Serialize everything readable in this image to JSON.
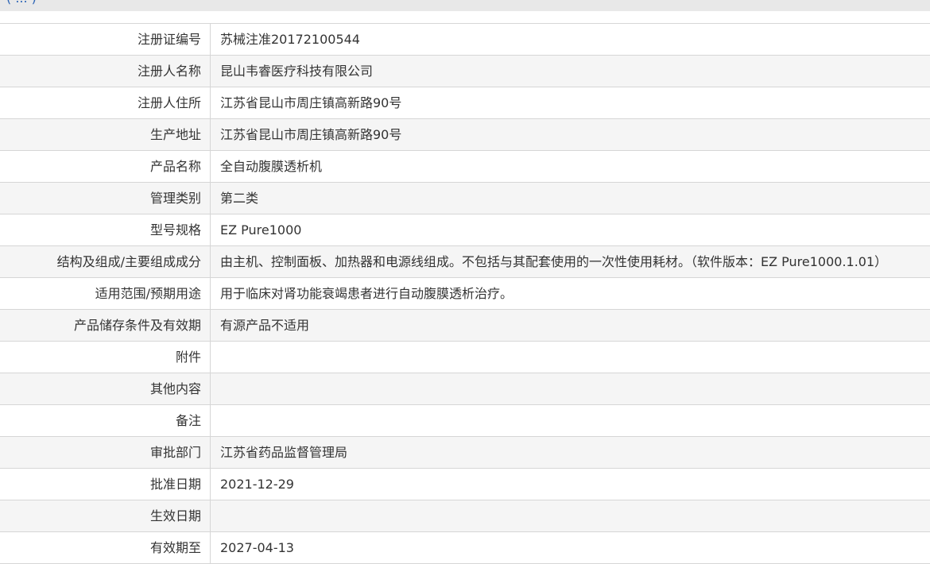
{
  "header": {
    "partial_text": "( ... )"
  },
  "rows": [
    {
      "label": "注册证编号",
      "value": "苏械注准20172100544"
    },
    {
      "label": "注册人名称",
      "value": "昆山韦睿医疗科技有限公司"
    },
    {
      "label": "注册人住所",
      "value": "江苏省昆山市周庄镇高新路90号"
    },
    {
      "label": "生产地址",
      "value": "江苏省昆山市周庄镇高新路90号"
    },
    {
      "label": "产品名称",
      "value": "全自动腹膜透析机"
    },
    {
      "label": "管理类别",
      "value": "第二类"
    },
    {
      "label": "型号规格",
      "value": "EZ Pure1000"
    },
    {
      "label": "结构及组成/主要组成成分",
      "value": "由主机、控制面板、加热器和电源线组成。不包括与其配套使用的一次性使用耗材。（软件版本：EZ Pure1000.1.01）"
    },
    {
      "label": "适用范围/预期用途",
      "value": "用于临床对肾功能衰竭患者进行自动腹膜透析治疗。"
    },
    {
      "label": "产品储存条件及有效期",
      "value": "有源产品不适用"
    },
    {
      "label": "附件",
      "value": ""
    },
    {
      "label": "其他内容",
      "value": ""
    },
    {
      "label": "备注",
      "value": ""
    },
    {
      "label": "审批部门",
      "value": "江苏省药品监督管理局"
    },
    {
      "label": "批准日期",
      "value": "2021-12-29"
    },
    {
      "label": "生效日期",
      "value": ""
    },
    {
      "label": "有效期至",
      "value": "2027-04-13"
    }
  ]
}
